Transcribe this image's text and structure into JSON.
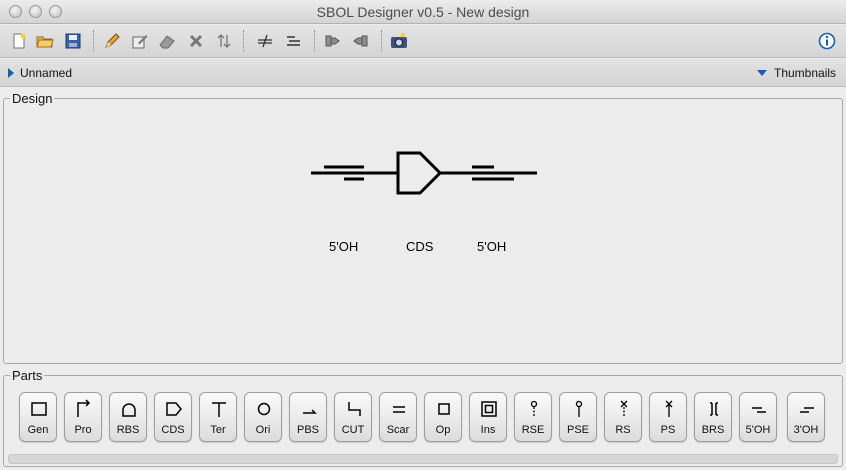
{
  "window": {
    "title": "SBOL Designer v0.5 - New design"
  },
  "toolbar": {
    "buttons": [
      "new-file",
      "open-folder",
      "save",
      "edit-pencil",
      "edit-part",
      "eraser",
      "delete",
      "flip",
      "hide-scars",
      "collapse",
      "focus-in",
      "focus-out",
      "snapshot",
      "info"
    ]
  },
  "infobar": {
    "design_name": "Unnamed",
    "thumbnails_label": "Thumbnails"
  },
  "design": {
    "label": "Design",
    "components": [
      {
        "type": "5OH",
        "label": "5'OH"
      },
      {
        "type": "CDS",
        "label": "CDS"
      },
      {
        "type": "5OH",
        "label": "5'OH"
      }
    ]
  },
  "parts": {
    "label": "Parts",
    "items": [
      "Gen",
      "Pro",
      "RBS",
      "CDS",
      "Ter",
      "Ori",
      "PBS",
      "CUT",
      "Scar",
      "Op",
      "Ins",
      "RSE",
      "PSE",
      "RS",
      "PS",
      "BRS",
      "5'OH",
      "3'OH"
    ]
  },
  "colors": {
    "accent": "#1a5cb0"
  }
}
